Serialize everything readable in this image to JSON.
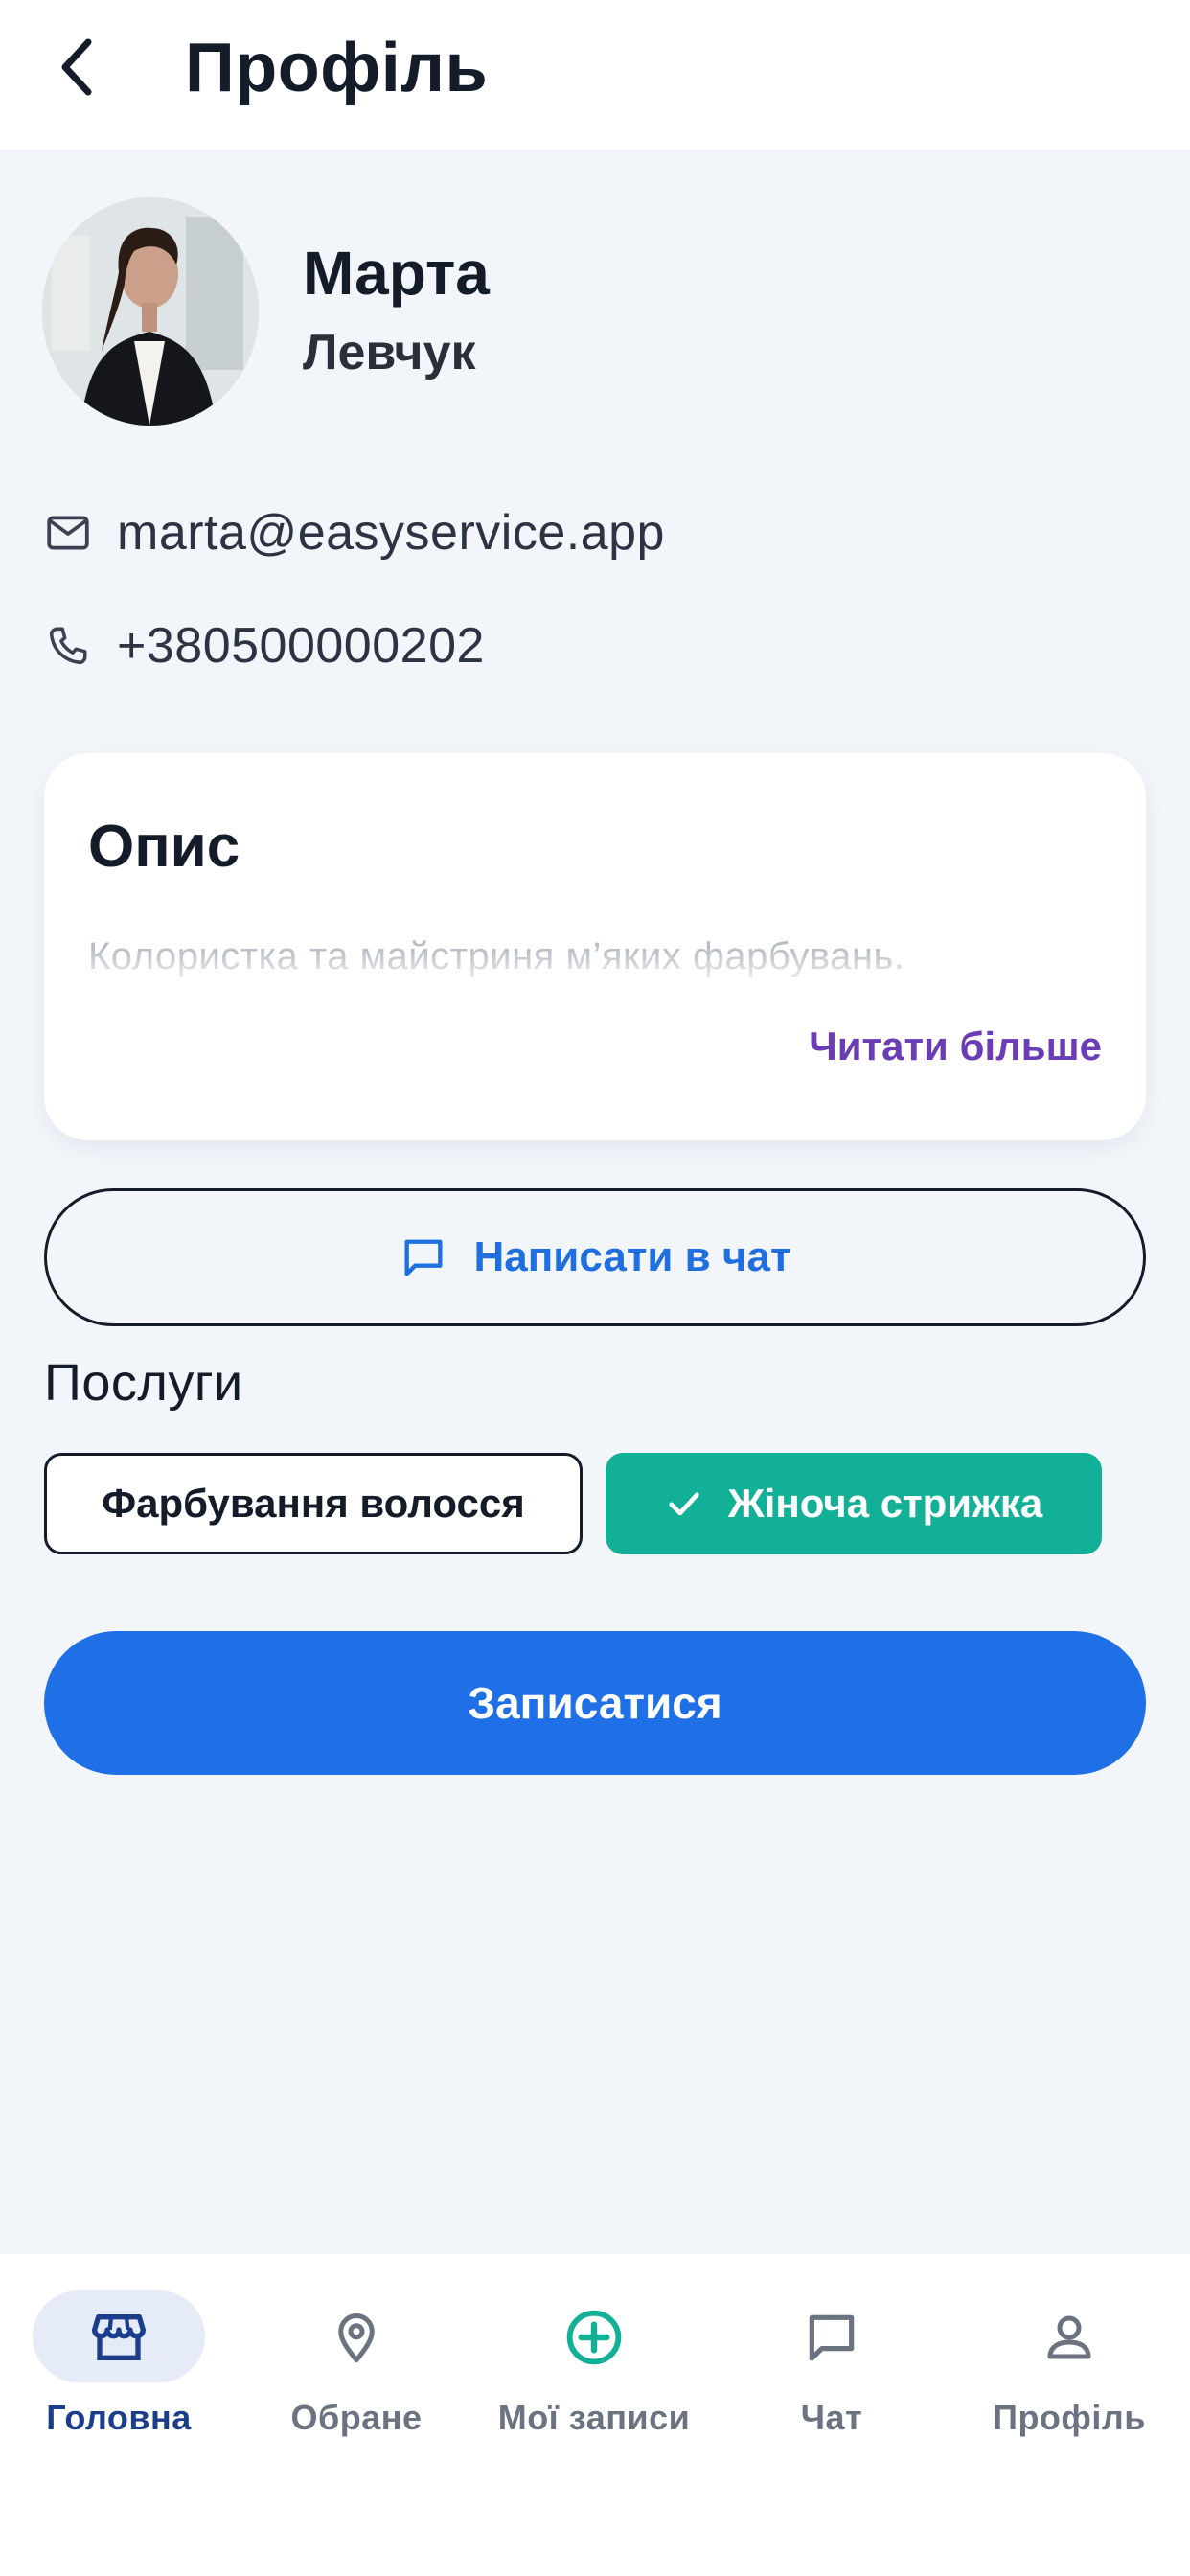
{
  "header": {
    "title": "Профіль"
  },
  "profile": {
    "first_name": "Марта",
    "last_name": "Левчук",
    "email": "marta@easyservice.app",
    "phone": "+380500000202"
  },
  "description_card": {
    "title": "Опис",
    "text": "Колористка та майстриня м’яких фарбувань.",
    "read_more": "Читати більше"
  },
  "chat_button": {
    "label": "Написати в чат",
    "icon": "chat-bubble-icon"
  },
  "services": {
    "title": "Послуги",
    "chips": [
      {
        "label": "Фарбування волосся",
        "selected": false
      },
      {
        "label": "Жіноча стрижка",
        "selected": true
      }
    ]
  },
  "book_button": {
    "label": "Записатися"
  },
  "bottom_nav": {
    "items": [
      {
        "label": "Головна",
        "icon": "storefront-icon",
        "active": true
      },
      {
        "label": "Обране",
        "icon": "location-pin-icon",
        "active": false
      },
      {
        "label": "Мої записи",
        "icon": "add-circle-icon",
        "active": false
      },
      {
        "label": "Чат",
        "icon": "chat-bubble-icon",
        "active": false
      },
      {
        "label": "Профіль",
        "icon": "person-icon",
        "active": false
      }
    ]
  },
  "colors": {
    "primary": "#1f6fe7",
    "accent_teal": "#12b096",
    "accent_purple": "#6a3cb5",
    "background": "#f2f5fa",
    "nav_active": "#1a3e8c"
  }
}
